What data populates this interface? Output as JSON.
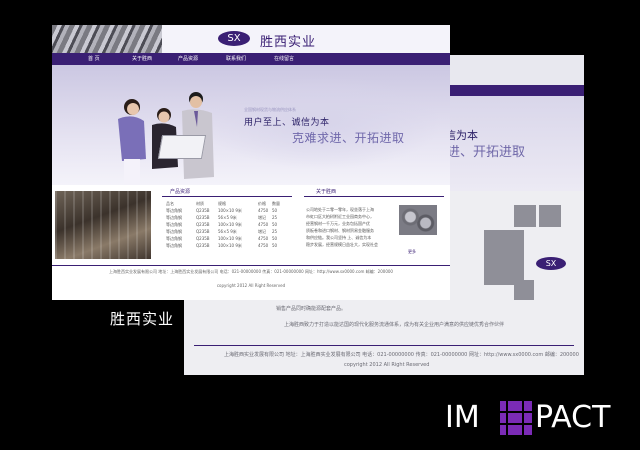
{
  "colors": {
    "brand": "#3a1f74",
    "accent": "#7068ab",
    "background": "#000000",
    "brand_mark": "#7b2bb6"
  },
  "main_site": {
    "logo": "SX",
    "company_name": "胜西实业",
    "nav": [
      "首 页",
      "关于胜西",
      "产品资源",
      "联系我们",
      "在线留言"
    ],
    "banner": {
      "small_text": "全国钢材现货与物流供应体系",
      "slogan_line1": "用户至上、诚信为本",
      "slogan_line2": "克难求进、开拓进取"
    },
    "products": {
      "title": "产品资源",
      "headers": [
        "品名",
        "材质",
        "规格",
        "价格",
        "数量"
      ],
      "rows": [
        [
          "等边角钢",
          "Q235B",
          "100×10 9米",
          "4750",
          "50"
        ],
        [
          "等边角钢",
          "Q235B",
          "56×5 9米",
          "增记",
          "25"
        ],
        [
          "等边角钢",
          "Q235B",
          "100×10 9米",
          "4750",
          "50"
        ],
        [
          "等边角钢",
          "Q235B",
          "56×5 9米",
          "增记",
          "25"
        ],
        [
          "等边角钢",
          "Q235B",
          "100×10 9米",
          "4750",
          "50"
        ],
        [
          "等边角钢",
          "Q235B",
          "100×10 9米",
          "4750",
          "50"
        ]
      ]
    },
    "about": {
      "title": "关于胜西",
      "lines": [
        "公司地处于二零一零年，现坐落于上海",
        "市虹口区大柏树附近工业园商务中心，",
        "经营钢材一千万元，业务包括国产优",
        "质板卷和进口钢材、钢材贸易金融服务",
        "和供应链。我公司坚持 上、诚信为本",
        "稳步发展，经营规模日益壮大，实现社会"
      ],
      "more": "更多"
    },
    "footer": {
      "line1": "上海胜西实业发展有限公司 地址：上海胜西实业发展有限公司 电话：021-00000000 传真：021-00000000 网址：http://www.sx0000.com 邮编：200000",
      "line2": "copyright 2012 All Right Reserved"
    }
  },
  "background_site": {
    "slogan_line1": "诚信为本",
    "slogan_line2": "求进、开拓进取",
    "logo": "SX",
    "text_lines": [
      "销售产品同时确能源配套产品。",
      "上海胜西致力于打造以能达国的现代化服务流通体系，成为有关企业用户满意的供应链优秀合作伙伴",
      "上海胜西实业发展有限公司 地址：上海胜西实业发展有限公司 电话：021-00000000 传真：021-00000000 网址：http://www.sx0000.com 邮编：200000",
      "copyright 2012 All Right Reserved"
    ]
  },
  "caption": "胜西实业",
  "brand": {
    "left": "IM",
    "right": "PACT",
    "mark_icon": "impact-logo-mark"
  }
}
